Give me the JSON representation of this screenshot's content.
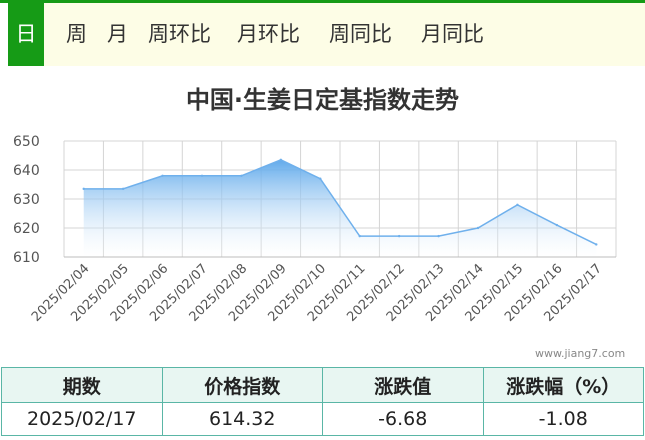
{
  "tabs": [
    {
      "label": "日",
      "active": true
    },
    {
      "label": "周"
    },
    {
      "label": "月"
    },
    {
      "label": "周环比"
    },
    {
      "label": "月环比"
    },
    {
      "label": "周同比"
    },
    {
      "label": "月同比"
    }
  ],
  "colors": {
    "accent": "#169b16",
    "series_line": "#6fb0ec",
    "table_border": "#5ab6a6"
  },
  "watermark": "www.jiang7.com",
  "chart_data": {
    "type": "area",
    "title": "中国·生姜日定基指数走势",
    "xlabel": "",
    "ylabel": "",
    "categories": [
      "2025/02/04",
      "2025/02/05",
      "2025/02/06",
      "2025/02/07",
      "2025/02/08",
      "2025/02/09",
      "2025/02/10",
      "2025/02/11",
      "2025/02/12",
      "2025/02/13",
      "2025/02/14",
      "2025/02/15",
      "2025/02/16",
      "2025/02/17"
    ],
    "values": [
      633.5,
      633.5,
      638,
      638,
      638,
      643.5,
      637,
      617.2,
      617.2,
      617.2,
      620,
      628,
      621,
      614.32
    ],
    "ylim": [
      610,
      650
    ],
    "yticks": [
      610,
      620,
      630,
      640,
      650
    ],
    "grid": true,
    "legend": "none"
  },
  "summary": {
    "headers": [
      "期数",
      "价格指数",
      "涨跌值",
      "涨跌幅（%）"
    ],
    "values": [
      "2025/02/17",
      "614.32",
      "-6.68",
      "-1.08"
    ]
  }
}
